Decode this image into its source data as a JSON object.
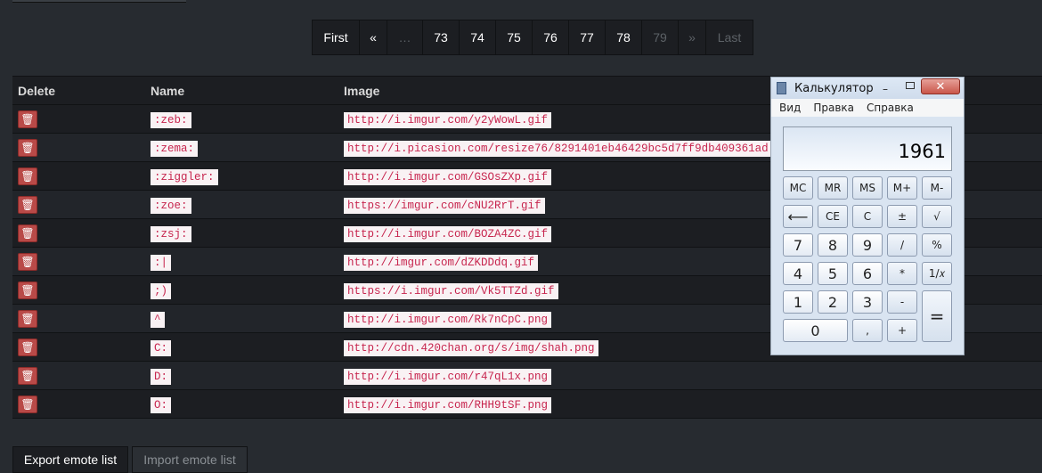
{
  "pagination": {
    "first": "First",
    "prev": "«",
    "ellipsis": "…",
    "pages": [
      "73",
      "74",
      "75",
      "76",
      "77",
      "78",
      "79"
    ],
    "next": "»",
    "last": "Last"
  },
  "table": {
    "headers": {
      "delete": "Delete",
      "name": "Name",
      "image": "Image"
    },
    "delete_icon": "trash-icon",
    "rows": [
      {
        "name": ":zeb:",
        "image": "http://i.imgur.com/y2yWowL.gif"
      },
      {
        "name": ":zema:",
        "image": "http://i.picasion.com/resize76/8291401eb46429bc5d7ff9db409361ad.gif"
      },
      {
        "name": ":ziggler:",
        "image": "http://i.imgur.com/GSOsZXp.gif"
      },
      {
        "name": ":zoe:",
        "image": "https://imgur.com/cNU2RrT.gif"
      },
      {
        "name": ":zsj:",
        "image": "http://i.imgur.com/BOZA4ZC.gif"
      },
      {
        "name": ":|",
        "image": "http://imgur.com/dZKDDdq.gif"
      },
      {
        "name": ";)",
        "image": "https://i.imgur.com/Vk5TTZd.gif"
      },
      {
        "name": "^",
        "image": "http://i.imgur.com/Rk7nCpC.png"
      },
      {
        "name": "C:",
        "image": "http://cdn.420chan.org/s/img/shah.png"
      },
      {
        "name": "D:",
        "image": "http://i.imgur.com/r47qL1x.png"
      },
      {
        "name": "O:",
        "image": "http://i.imgur.com/RHH9tSF.png"
      }
    ]
  },
  "buttons": {
    "export": "Export emote list",
    "import": "Import emote list"
  },
  "calculator": {
    "title": "Калькулятор",
    "menu": [
      "Вид",
      "Правка",
      "Справка"
    ],
    "display": "1961",
    "close": "✕",
    "minimize": "–",
    "keys": {
      "mc": "MC",
      "mr": "MR",
      "ms": "MS",
      "mplus": "M+",
      "mminus": "M-",
      "back": "⟵",
      "ce": "CE",
      "c": "C",
      "pm": "±",
      "sqrt": "√",
      "k7": "7",
      "k8": "8",
      "k9": "9",
      "div": "/",
      "pct": "%",
      "k4": "4",
      "k5": "5",
      "k6": "6",
      "mul": "*",
      "inv": "1/𝑥",
      "k1": "1",
      "k2": "2",
      "k3": "3",
      "sub": "-",
      "eq": "=",
      "k0": "0",
      "dot": ",",
      "add": "+"
    }
  }
}
